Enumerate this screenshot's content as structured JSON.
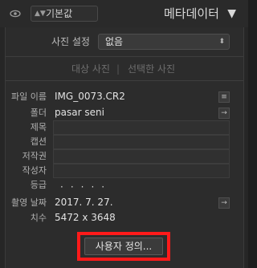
{
  "header": {
    "preset_label": "기본값",
    "title": "메타데이터",
    "collapse_icon": "▼",
    "preset_arrow": "▲▼"
  },
  "photo_setting": {
    "label": "사진 설정",
    "value": "없음"
  },
  "target_tabs": {
    "target_label": "대상 사진",
    "separator": "|",
    "selected_label": "선택한 사진"
  },
  "fields": {
    "filename": {
      "label": "파일 이름",
      "value": "IMG_0073.CR2"
    },
    "folder": {
      "label": "폴더",
      "value": "pasar seni"
    },
    "title": {
      "label": "제목",
      "value": ""
    },
    "caption": {
      "label": "캡션",
      "value": ""
    },
    "copyright": {
      "label": "저작권",
      "value": ""
    },
    "creator": {
      "label": "작성자",
      "value": ""
    },
    "rating": {
      "label": "등급",
      "value": "·····"
    },
    "capture_date": {
      "label": "촬영 날짜",
      "value": "2017. 7. 27."
    },
    "dimensions": {
      "label": "치수",
      "value": "5472 x 3648"
    }
  },
  "buttons": {
    "define_label": "사용자 정의...",
    "side_arrow": "→",
    "side_list": "≡"
  },
  "colors": {
    "highlight": "#ff1a1a",
    "background": "#262626"
  }
}
